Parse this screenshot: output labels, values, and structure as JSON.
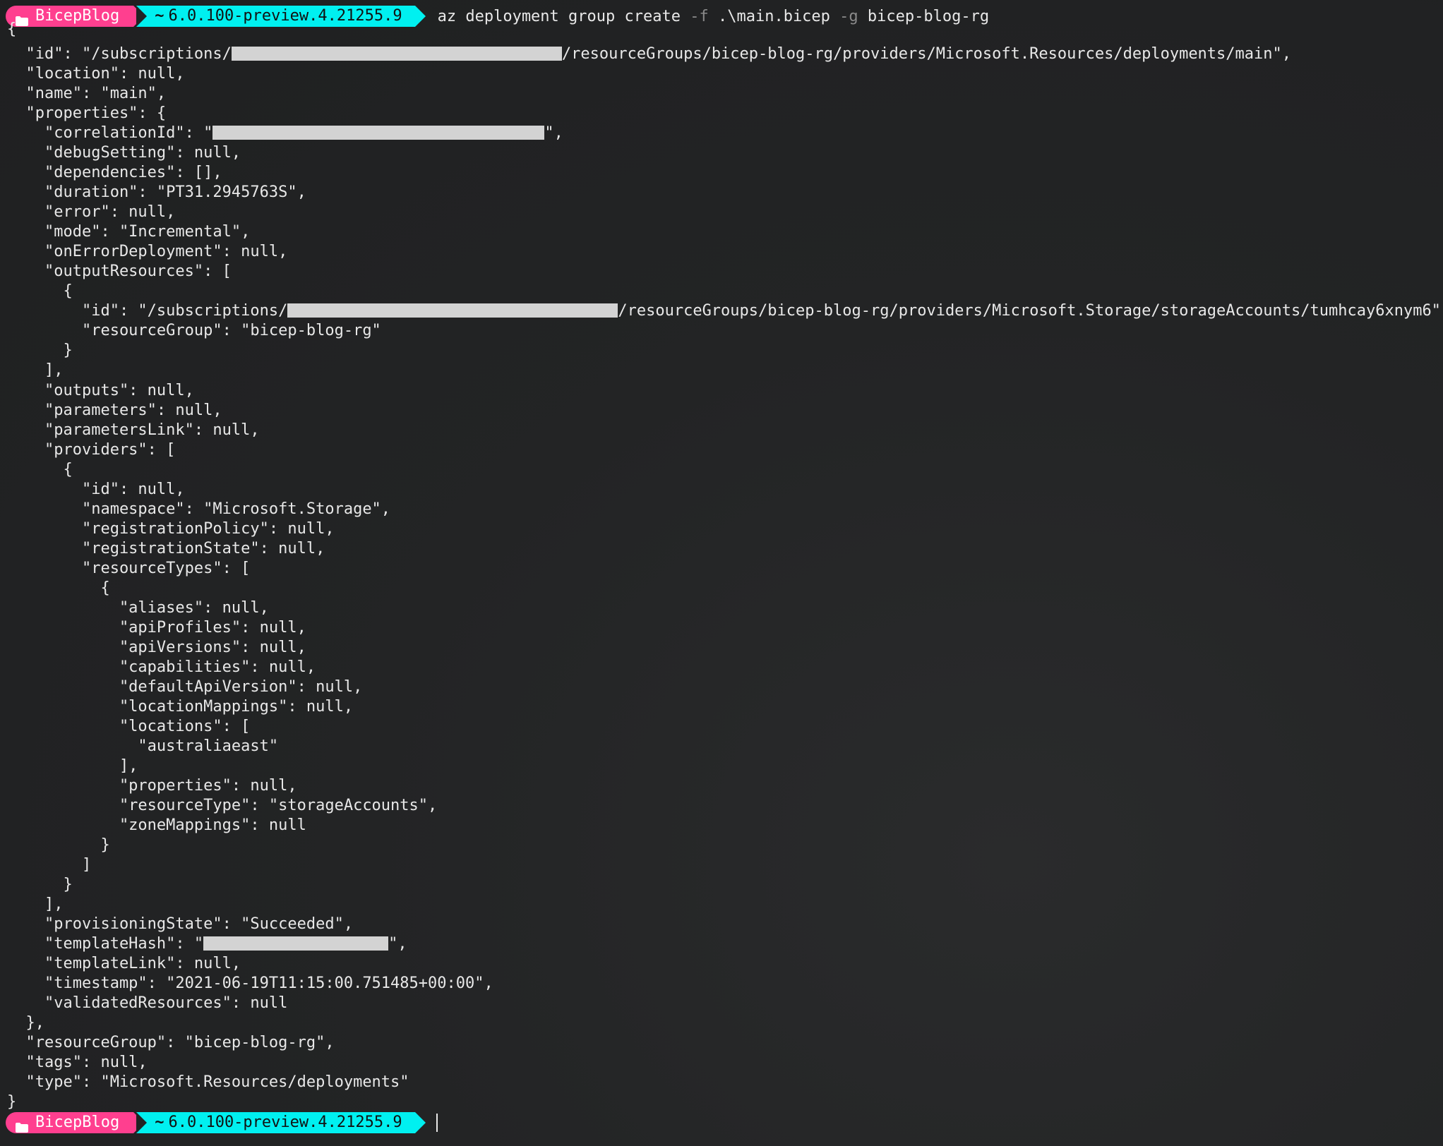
{
  "prompt": {
    "folder_icon": "folder-icon",
    "folder": "BicepBlog",
    "sdk_icon": "tilde-icon",
    "sdk_glyph": "~",
    "sdk_version": "6.0.100-preview.4.21255.9",
    "colors": {
      "folder_segment": "#ff3f8f",
      "sdk_segment": "#00f0f0",
      "redaction": "#d3d3d3"
    }
  },
  "command": {
    "program": "az deployment group create ",
    "flag_file": "-f",
    "file_arg": " .\\main.bicep ",
    "flag_group": "-g",
    "group_arg": " bicep-blog-rg"
  },
  "output": {
    "l01": "{",
    "l02a": "  \"id\": \"/subscriptions/",
    "l02b": "/resourceGroups/bicep-blog-rg/providers/Microsoft.Resources/deployments/main\",",
    "l03": "  \"location\": null,",
    "l04": "  \"name\": \"main\",",
    "l05": "  \"properties\": {",
    "l06a": "    \"correlationId\": \"",
    "l06b": "\",",
    "l07": "    \"debugSetting\": null,",
    "l08": "    \"dependencies\": [],",
    "l09": "    \"duration\": \"PT31.2945763S\",",
    "l10": "    \"error\": null,",
    "l11": "    \"mode\": \"Incremental\",",
    "l12": "    \"onErrorDeployment\": null,",
    "l13": "    \"outputResources\": [",
    "l14": "      {",
    "l15a": "        \"id\": \"/subscriptions/",
    "l15b": "/resourceGroups/bicep-blog-rg/providers/Microsoft.Storage/storageAccounts/tumhcay6xnym6\",",
    "l16": "        \"resourceGroup\": \"bicep-blog-rg\"",
    "l17": "      }",
    "l18": "    ],",
    "l19": "    \"outputs\": null,",
    "l20": "    \"parameters\": null,",
    "l21": "    \"parametersLink\": null,",
    "l22": "    \"providers\": [",
    "l23": "      {",
    "l24": "        \"id\": null,",
    "l25": "        \"namespace\": \"Microsoft.Storage\",",
    "l26": "        \"registrationPolicy\": null,",
    "l27": "        \"registrationState\": null,",
    "l28": "        \"resourceTypes\": [",
    "l29": "          {",
    "l30": "            \"aliases\": null,",
    "l31": "            \"apiProfiles\": null,",
    "l32": "            \"apiVersions\": null,",
    "l33": "            \"capabilities\": null,",
    "l34": "            \"defaultApiVersion\": null,",
    "l35": "            \"locationMappings\": null,",
    "l36": "            \"locations\": [",
    "l37": "              \"australiaeast\"",
    "l38": "            ],",
    "l39": "            \"properties\": null,",
    "l40": "            \"resourceType\": \"storageAccounts\",",
    "l41": "            \"zoneMappings\": null",
    "l42": "          }",
    "l43": "        ]",
    "l44": "      }",
    "l45": "    ],",
    "l46": "    \"provisioningState\": \"Succeeded\",",
    "l47a": "    \"templateHash\": \"",
    "l47b": "\",",
    "l48": "    \"templateLink\": null,",
    "l49": "    \"timestamp\": \"2021-06-19T11:15:00.751485+00:00\",",
    "l50": "    \"validatedResources\": null",
    "l51": "  },",
    "l52": "  \"resourceGroup\": \"bicep-blog-rg\",",
    "l53": "  \"tags\": null,",
    "l54": "  \"type\": \"Microsoft.Resources/deployments\"",
    "l55": "}"
  }
}
